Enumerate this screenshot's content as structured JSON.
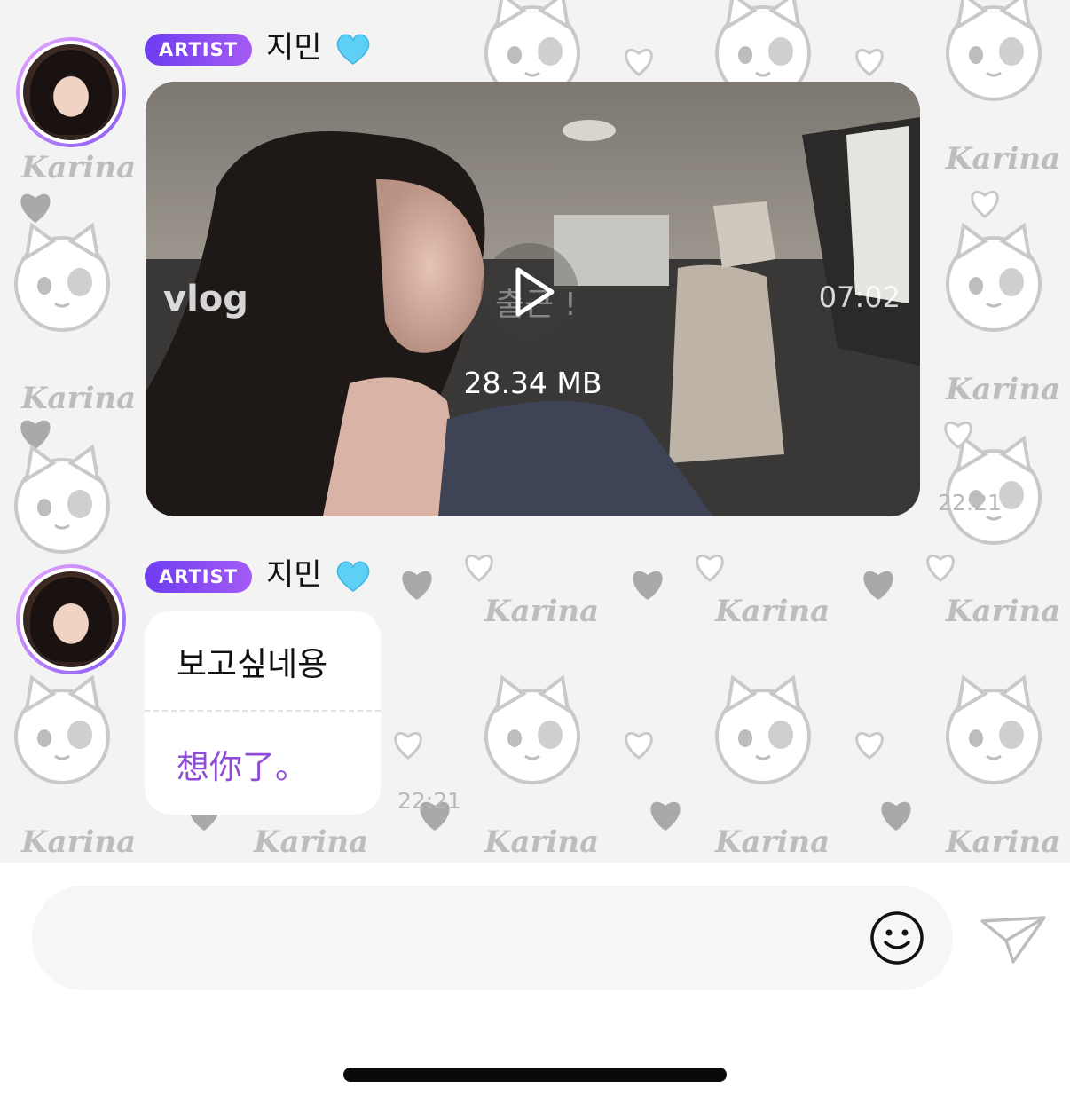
{
  "messages": [
    {
      "badge": "ARTIST",
      "sender": "지민",
      "type": "video",
      "video": {
        "thumbnail_left_text": "vlog",
        "thumbnail_center_text": "출근 !",
        "duration": "07:02",
        "file_size": "28.34 MB"
      },
      "time": "22:21"
    },
    {
      "badge": "ARTIST",
      "sender": "지민",
      "type": "text",
      "text": "보고싶네용",
      "translation": "想你了。",
      "time": "22:21"
    }
  ],
  "wallpaper": {
    "repeated_text": "Karina"
  },
  "composer": {
    "placeholder": "",
    "emoji_icon": "smiley-icon",
    "send_icon": "paper-plane-icon"
  },
  "colors": {
    "badge_gradient_start": "#6d3cf0",
    "badge_gradient_end": "#a45bf5",
    "translation_text": "#8e4bd6",
    "heart_emoji": "#5fd0f5",
    "timestamp": "#b9b9b9"
  }
}
